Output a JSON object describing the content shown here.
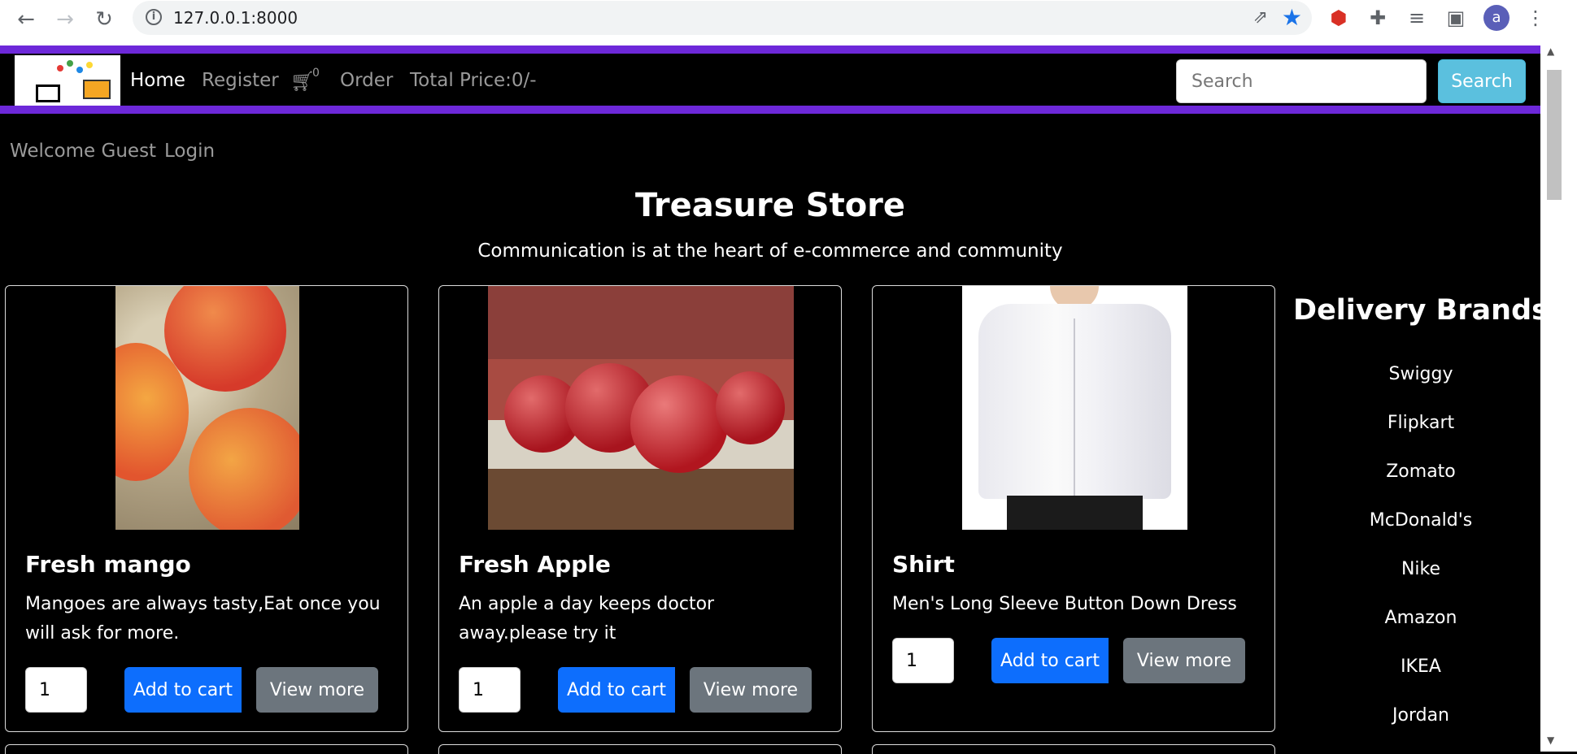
{
  "browser": {
    "url": "127.0.0.1:8000",
    "avatar_letter": "a"
  },
  "navbar": {
    "home": "Home",
    "register": "Register",
    "cart_count": "0",
    "order": "Order",
    "total_price": "Total Price:0/-",
    "search_placeholder": "Search",
    "search_button": "Search"
  },
  "user": {
    "welcome": "Welcome Guest",
    "login": "Login"
  },
  "store": {
    "title": "Treasure Store",
    "subtitle": "Communication is at the heart of e-commerce and community"
  },
  "products": [
    {
      "title": "Fresh mango",
      "description": "Mangoes are always tasty,Eat once you will ask for more.",
      "quantity": "1",
      "add_label": "Add to cart",
      "more_label": "View more"
    },
    {
      "title": "Fresh Apple",
      "description": "An apple a day keeps doctor away.please try it",
      "quantity": "1",
      "add_label": "Add to cart",
      "more_label": "View more"
    },
    {
      "title": "Shirt",
      "description": "Men's Long Sleeve Button Down Dress",
      "quantity": "1",
      "add_label": "Add to cart",
      "more_label": "View more"
    }
  ],
  "brands": {
    "heading": "Delivery Brands",
    "items": [
      "Swiggy",
      "Flipkart",
      "Zomato",
      "McDonald's",
      "Nike",
      "Amazon",
      "IKEA",
      "Jordan"
    ]
  },
  "colors": {
    "accent_purple": "#6d28d9",
    "primary_blue": "#0d6efd",
    "secondary_gray": "#6c757d",
    "search_button": "#5bc0de"
  }
}
